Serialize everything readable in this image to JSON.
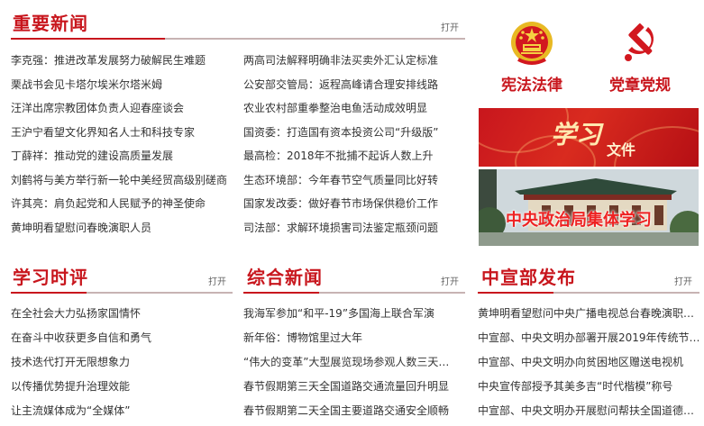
{
  "important_news": {
    "title": "重要新闻",
    "open": "打开",
    "left_items": [
      "李克强：推进改革发展努力破解民生难题",
      "栗战书会见卡塔尔埃米尔塔米姆",
      "汪洋出席宗教团体负责人迎春座谈会",
      "王沪宁看望文化界知名人士和科技专家",
      "丁薛祥：推动党的建设高质量发展",
      "刘鹤将与美方举行新一轮中美经贸高级别磋商",
      "许其亮：肩负起党和人民赋予的神圣使命",
      "黄坤明看望慰问春晚演职人员"
    ],
    "right_items": [
      "两高司法解释明确非法买卖外汇认定标准",
      "公安部交管局：返程高峰请合理安排线路",
      "农业农村部重拳整治电鱼活动成效明显",
      "国资委：打造国有资本投资公司“升级版”",
      "最高检：2018年不批捕不起诉人数上升",
      "生态环境部：今年春节空气质量同比好转",
      "国家发改委：做好春节市场保供稳价工作",
      "司法部：求解环境损害司法鉴定瓶颈问题"
    ]
  },
  "sidebar": {
    "constitution_label": "宪法法律",
    "party_label": "党章党规",
    "study_banner_calligraphy": "学习",
    "study_banner_caption": "文件",
    "politburo_banner_caption": "中央政治局集体学习"
  },
  "study_commentary": {
    "title": "学习时评",
    "open": "打开",
    "items": [
      "在全社会大力弘扬家国情怀",
      "在奋斗中收获更多自信和勇气",
      "技术迭代打开无限想象力",
      "以传播优势提升治理效能",
      "让主流媒体成为“全媒体”"
    ]
  },
  "general_news": {
    "title": "综合新闻",
    "open": "打开",
    "items": [
      "我海军参加“和平-19”多国海上联合军演",
      "新年俗：博物馆里过大年",
      "“伟大的变革”大型展览现场参观人数三天…",
      "春节假期第三天全国道路交通流量回升明显",
      "春节假期第二天全国主要道路交通安全顺畅"
    ]
  },
  "publicity_dept": {
    "title": "中宣部发布",
    "open": "打开",
    "items": [
      "黄坤明看望慰问中央广播电视总台春晚演职…",
      "中宣部、中央文明办部署开展2019年传统节…",
      "中宣部、中央文明办向贫困地区赠送电视机",
      "中央宣传部授予其美多吉“时代楷模”称号",
      "中宣部、中央文明办开展慰问帮扶全国道德…"
    ]
  },
  "colors": {
    "accent_red": "#c8161d",
    "text": "#333333",
    "rule_gray": "#c7b3b3"
  }
}
